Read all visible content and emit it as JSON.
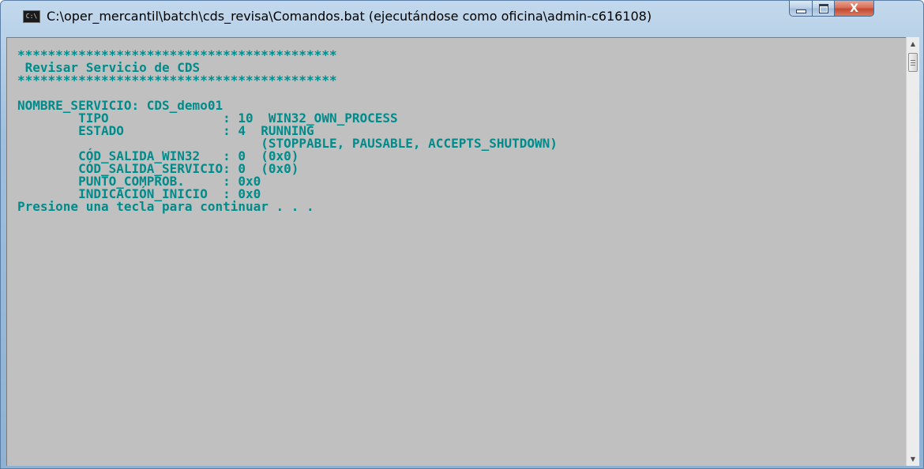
{
  "window": {
    "title": "C:\\oper_mercantil\\batch\\cds_revisa\\Comandos.bat (ejecutándose como oficina\\admin-c616108)",
    "app_icon": "console-app-icon",
    "app_icon_text": "C:\\",
    "controls": {
      "minimize_icon": "minimize-icon",
      "maximize_icon": "maximize-icon",
      "close_icon": "close-icon",
      "close_glyph": "X"
    }
  },
  "console": {
    "text_color": "#008b8b",
    "background": "#c0c0c0",
    "lines": [
      "******************************************",
      " Revisar Servicio de CDS",
      "******************************************",
      "",
      "NOMBRE_SERVICIO: CDS_demo01",
      "        TIPO               : 10  WIN32_OWN_PROCESS",
      "        ESTADO             : 4  RUNNING",
      "                                (STOPPABLE, PAUSABLE, ACCEPTS_SHUTDOWN)",
      "        CÓD_SALIDA_WIN32   : 0  (0x0)",
      "        CÓD_SALIDA_SERVICIO: 0  (0x0)",
      "        PUNTO_COMPROB.     : 0x0",
      "        INDICACIÓN_INICIO  : 0x0",
      "Presione una tecla para continuar . . ."
    ]
  },
  "scrollbar": {
    "up_icon": "scroll-up-arrow-icon",
    "down_icon": "scroll-down-arrow-icon",
    "up_glyph": "▲",
    "down_glyph": "▼"
  }
}
